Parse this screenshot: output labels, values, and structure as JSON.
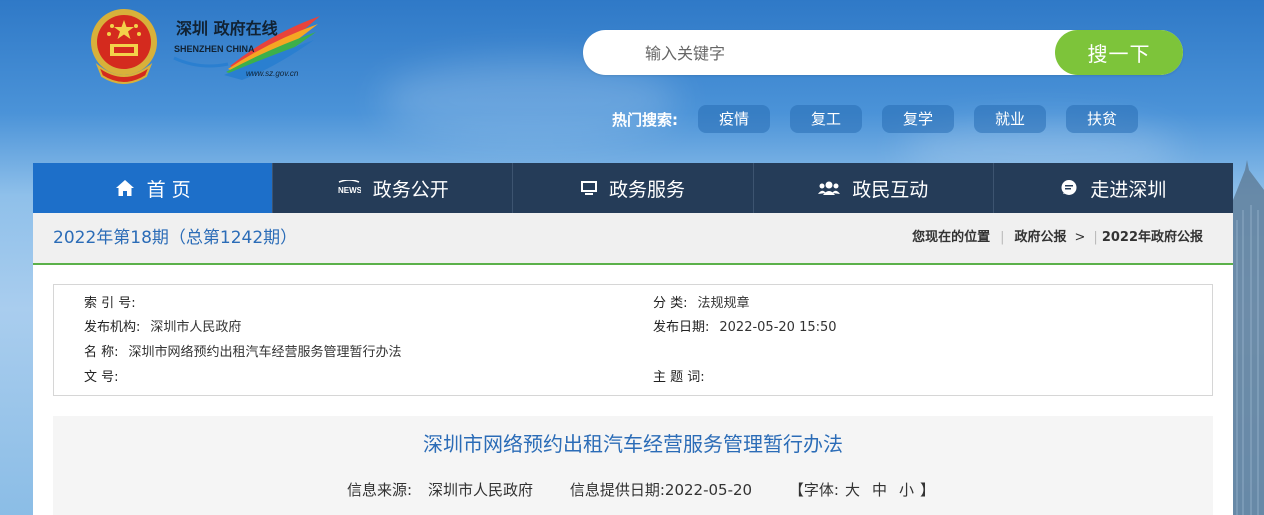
{
  "site": {
    "logo_cn": "深圳 政府在线",
    "logo_en": "SHENZHEN CHINA",
    "logo_url": "www.sz.gov.cn"
  },
  "search": {
    "placeholder": "输入关键字",
    "button": "搜一下"
  },
  "hot": {
    "label": "热门搜索:",
    "tags": [
      "疫情",
      "复工",
      "复学",
      "就业",
      "扶贫"
    ]
  },
  "nav": {
    "items": [
      {
        "label": "首 页",
        "icon": "home-icon"
      },
      {
        "label": "政务公开",
        "icon": "news-icon"
      },
      {
        "label": "政务服务",
        "icon": "monitor-icon"
      },
      {
        "label": "政民互动",
        "icon": "people-icon"
      },
      {
        "label": "走进深圳",
        "icon": "chat-bubble-icon"
      }
    ]
  },
  "issue": {
    "title": "2022年第18期（总第1242期）"
  },
  "breadcrumb": {
    "label": "您现在的位置",
    "items": [
      "政府公报",
      "2022年政府公报"
    ]
  },
  "meta": {
    "index_label": "索 引 号:",
    "index_value": "",
    "category_label": "分 类:",
    "category_value": "法规规章",
    "issuer_label": "发布机构:",
    "issuer_value": "深圳市人民政府",
    "date_label": "发布日期:",
    "date_value": "2022-05-20 15:50",
    "name_label": "名 称:",
    "name_value": "深圳市网络预约出租汽车经营服务管理暂行办法",
    "subject_label": "主 题 词:",
    "subject_value": "",
    "docno_label": "文 号:",
    "docno_value": ""
  },
  "article": {
    "title": "深圳市网络预约出租汽车经营服务管理暂行办法",
    "source_label": "信息来源:",
    "source_value": "深圳市人民政府",
    "provide_label": "信息提供日期:",
    "provide_value": "2022-05-20",
    "font_label": "【字体:",
    "font_large": "大",
    "font_medium": "中",
    "font_small": "小",
    "font_end": "】"
  },
  "colors": {
    "accent_blue": "#1d6fc9",
    "nav_dark": "#253c58",
    "search_green": "#7dc43a",
    "title_blue": "#2b6cb7",
    "divider_green": "#5bb14a"
  }
}
